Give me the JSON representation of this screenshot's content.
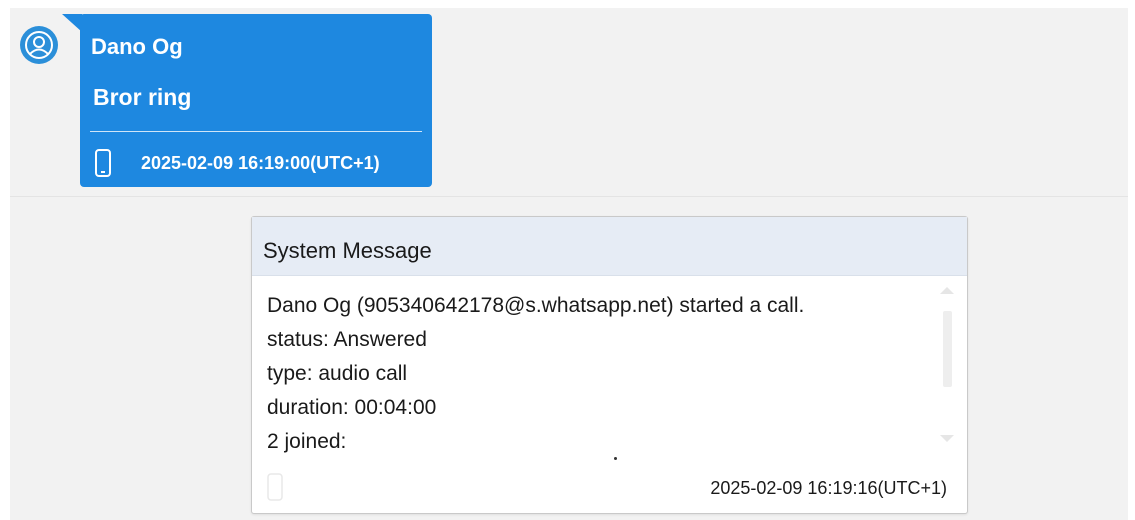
{
  "colors": {
    "bubble_bg": "#1e88e0",
    "avatar_bg": "#2b8fd9",
    "system_header_bg": "#e6ecf5"
  },
  "incoming_message": {
    "avatar_icon": "user-icon",
    "sender": "Dano Og",
    "text": "Bror ring",
    "device_icon": "phone-icon",
    "timestamp": "2025-02-09 16:19:00(UTC+1)"
  },
  "system_message": {
    "title": "System Message",
    "lines": [
      "Dano Og (905340642178@s.whatsapp.net) started a call.",
      "status: Answered",
      "type: audio call",
      "duration: 00:04:00",
      "2 joined:"
    ],
    "device_icon": "phone-icon",
    "timestamp": "2025-02-09 16:19:16(UTC+1)"
  }
}
